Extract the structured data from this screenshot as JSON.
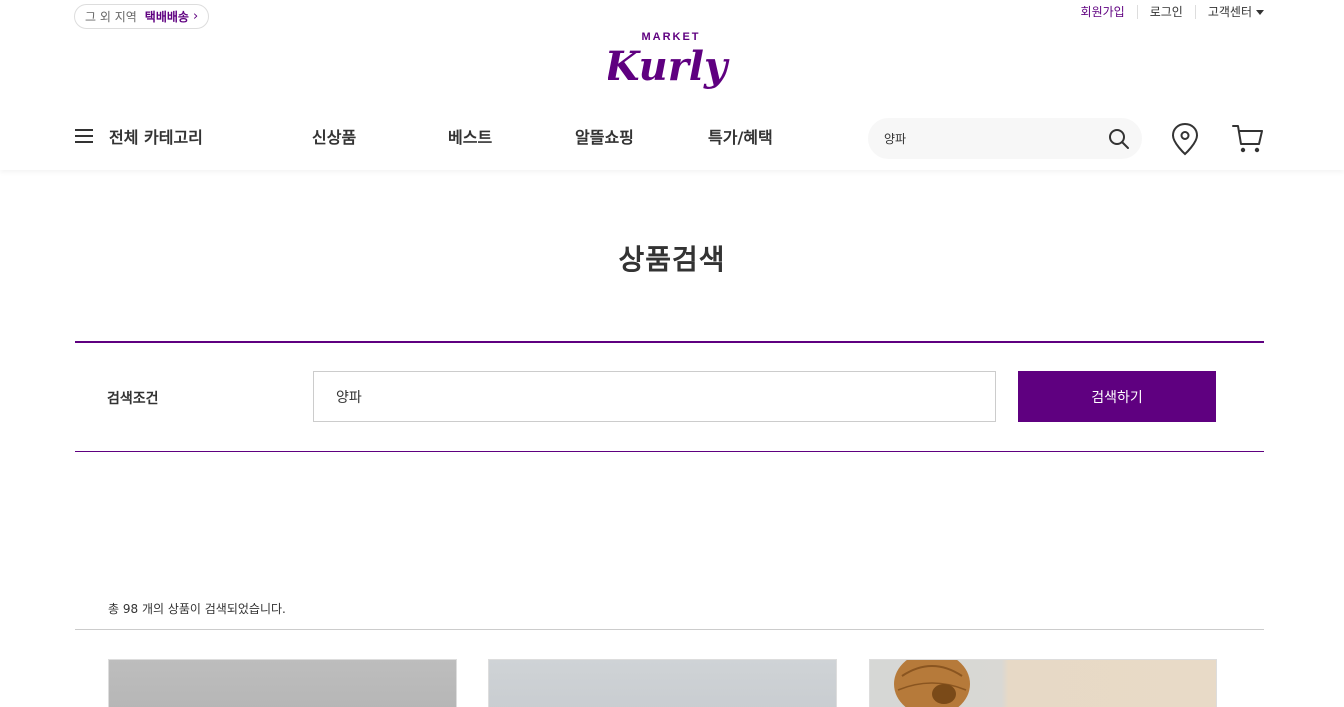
{
  "delivery": {
    "region_label": "그 외 지역",
    "courier_label": "택배배송",
    "chevron": "›"
  },
  "user_menu": {
    "signup": "회원가입",
    "login": "로그인",
    "customer_center": "고객센터"
  },
  "logo": {
    "top_text": "MARKET",
    "main_text": "Kurly",
    "brand_color": "#5f0080"
  },
  "gnb": {
    "all_categories": "전체 카테고리",
    "items": [
      "신상품",
      "베스트",
      "알뜰쇼핑",
      "특가/혜택"
    ],
    "search_value": "양파",
    "icons": [
      "hamburger-icon",
      "search-icon",
      "location-pin-icon",
      "cart-icon"
    ]
  },
  "page": {
    "title": "상품검색"
  },
  "search_form": {
    "label": "검색조건",
    "value": "양파",
    "button": "검색하기"
  },
  "results": {
    "count_text": "총 98 개의 상품이 검색되었습니다."
  },
  "colors": {
    "accent": "#5f0080",
    "text": "#333333",
    "border": "#dddddd"
  }
}
